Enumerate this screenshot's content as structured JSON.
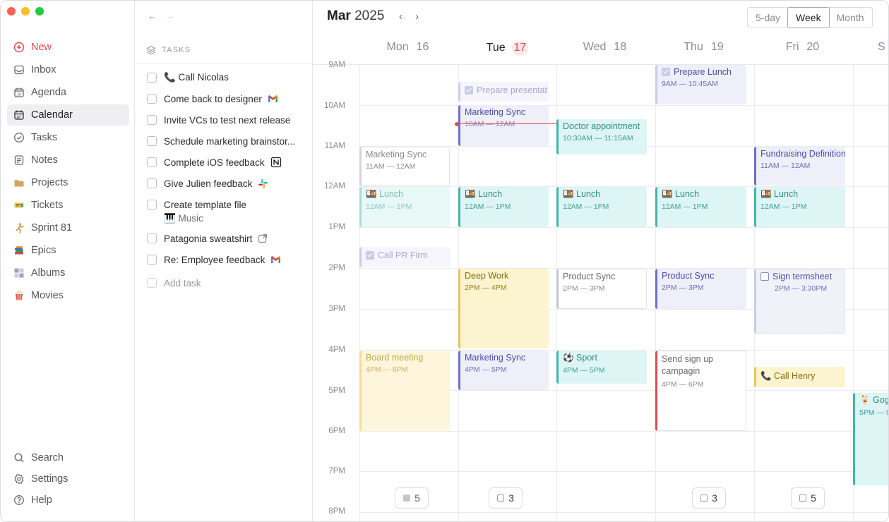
{
  "sidebar": {
    "items": [
      {
        "label": "New",
        "icon": "plus-circle-icon"
      },
      {
        "label": "Inbox",
        "icon": "inbox-icon"
      },
      {
        "label": "Agenda",
        "icon": "agenda-calendar-icon"
      },
      {
        "label": "Calendar",
        "icon": "calendar-icon"
      },
      {
        "label": "Tasks",
        "icon": "check-circle-icon"
      },
      {
        "label": "Notes",
        "icon": "note-icon"
      },
      {
        "label": "Projects",
        "icon": "folder-icon"
      },
      {
        "label": "Tickets",
        "icon": "ticket-icon"
      },
      {
        "label": "Sprint 81",
        "icon": "runner-icon"
      },
      {
        "label": "Epics",
        "icon": "books-icon"
      },
      {
        "label": "Albums",
        "icon": "albums-icon"
      },
      {
        "label": "Movies",
        "icon": "popcorn-icon"
      }
    ],
    "bottom": [
      {
        "label": "Search",
        "icon": "search-icon"
      },
      {
        "label": "Settings",
        "icon": "gear-icon"
      },
      {
        "label": "Help",
        "icon": "help-icon"
      }
    ]
  },
  "tasks": {
    "header": "TASKS",
    "items": [
      {
        "text": "📞 Call Nicolas"
      },
      {
        "text": "Come back to designer",
        "badge": "gmail"
      },
      {
        "text": "Invite VCs to test next release"
      },
      {
        "text": "Schedule marketing brainstor..."
      },
      {
        "text": "Complete iOS feedback",
        "badge": "notion"
      },
      {
        "text": "Give Julien feedback",
        "badge": "slack"
      },
      {
        "text": "Create template file"
      },
      {
        "text": "🎹 Music"
      },
      {
        "text": "Patagonia sweatshirt",
        "badge": "link"
      },
      {
        "text": "Re: Employee feedback",
        "badge": "gmail"
      }
    ],
    "add_label": "Add task"
  },
  "calendar": {
    "month": "Mar",
    "year": "2025",
    "views": [
      "5-day",
      "Week",
      "Month"
    ],
    "active_view": "Week",
    "days": [
      {
        "name": "Mon",
        "num": "16"
      },
      {
        "name": "Tue",
        "num": "17"
      },
      {
        "name": "Wed",
        "num": "18"
      },
      {
        "name": "Thu",
        "num": "19"
      },
      {
        "name": "Fri",
        "num": "20"
      },
      {
        "name": "S",
        "num": ""
      }
    ],
    "hours": [
      "9AM",
      "10AM",
      "11AM",
      "12AM",
      "1PM",
      "2PM",
      "3PM",
      "4PM",
      "5PM",
      "6PM",
      "7PM",
      "8PM"
    ],
    "events": {
      "mon_marketing": {
        "title": "Marketing Sync",
        "time": "11AM — 12AM"
      },
      "mon_lunch": {
        "title": "🍱 Lunch",
        "time": "12AM — 1PM"
      },
      "mon_callpr": {
        "title": "Call PR Firm"
      },
      "mon_board": {
        "title": "Board meeting",
        "time": "4PM — 6PM"
      },
      "tue_prepare": {
        "title": "Prepare presentat"
      },
      "tue_marketing1": {
        "title": "Marketing Sync",
        "time": "10AM — 12AM"
      },
      "tue_lunch": {
        "title": "🍱 Lunch",
        "time": "12AM — 1PM"
      },
      "tue_deep": {
        "title": "Deep Work",
        "time": "2PM — 4PM"
      },
      "tue_marketing2": {
        "title": "Marketing Sync",
        "time": "4PM — 5PM"
      },
      "wed_doctor": {
        "title": "Doctor appointment",
        "time": "10:30AM — 11:15AM"
      },
      "wed_lunch": {
        "title": "🍱 Lunch",
        "time": "12AM — 1PM"
      },
      "wed_product": {
        "title": "Product Sync",
        "time": "2PM — 3PM"
      },
      "wed_sport": {
        "title": "⚽ Sport",
        "time": "4PM — 5PM"
      },
      "thu_prepare": {
        "title": "Prepare Lunch",
        "time": "9AM — 10:45AM"
      },
      "thu_lunch": {
        "title": "🍱 Lunch",
        "time": "12AM — 1PM"
      },
      "thu_product": {
        "title": "Product Sync",
        "time": "2PM — 3PM"
      },
      "thu_signup": {
        "title": "Send sign up campagin",
        "time": "4PM — 6PM"
      },
      "fri_fund": {
        "title": "Fundraising Definition",
        "time": "11AM — 12AM"
      },
      "fri_lunch": {
        "title": "🍱 Lunch",
        "time": "12AM — 1PM"
      },
      "fri_sign": {
        "title": "Sign termsheet",
        "time": "2PM — 3:30PM"
      },
      "fri_henry": {
        "title": "📞 Call Henry"
      },
      "sat_gogo": {
        "title": "🍹 Gogo",
        "time": "5PM — 9"
      }
    },
    "task_counts": {
      "mon": "5",
      "tue": "3",
      "thu": "3",
      "fri": "5"
    }
  },
  "colors": {
    "accent_red": "#e5484d",
    "purple": "#6b6fd0",
    "teal": "#43b3ac",
    "yellow": "#e6c45a"
  }
}
